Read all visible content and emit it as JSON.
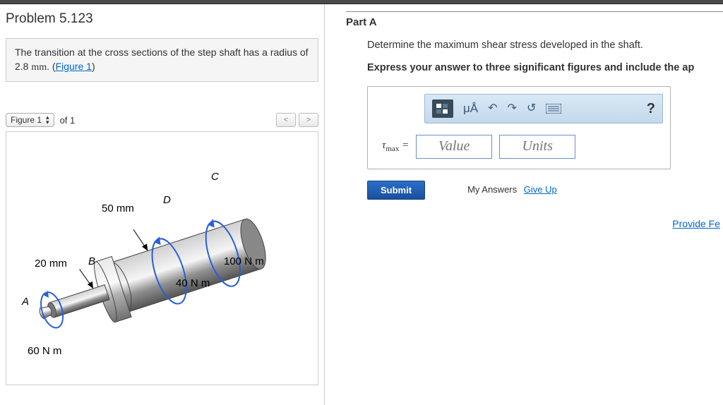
{
  "problem": {
    "title": "Problem 5.123",
    "text_1": "The transition at the cross sections of the step shaft has a radius of 2.8 ",
    "unit": "mm",
    "text_2": ". (",
    "figure_link": "Figure 1",
    "text_3": ")"
  },
  "figure_nav": {
    "label": "Figure 1",
    "of": "of 1",
    "prev": "<",
    "next": ">"
  },
  "figure_labels": {
    "A": "A",
    "B": "B",
    "C": "C",
    "D": "D",
    "d_small": "20 mm",
    "d_large": "50 mm",
    "torque_A": "60 N m",
    "torque_B": "40 N m",
    "torque_C": "100 N m"
  },
  "part": {
    "title": "Part A",
    "prompt": "Determine the maximum shear stress developed in the shaft.",
    "instruction": "Express your answer to three significant figures and include the ap"
  },
  "toolbar": {
    "units_btn": "μÅ",
    "help": "?"
  },
  "answer": {
    "var_html": "τ",
    "var_sub": "max",
    "equals": " = ",
    "value_placeholder": "Value",
    "units_placeholder": "Units"
  },
  "actions": {
    "submit": "Submit",
    "my_answers": "My Answers",
    "give_up": "Give Up"
  },
  "feedback": {
    "provide": "Provide Fe"
  }
}
